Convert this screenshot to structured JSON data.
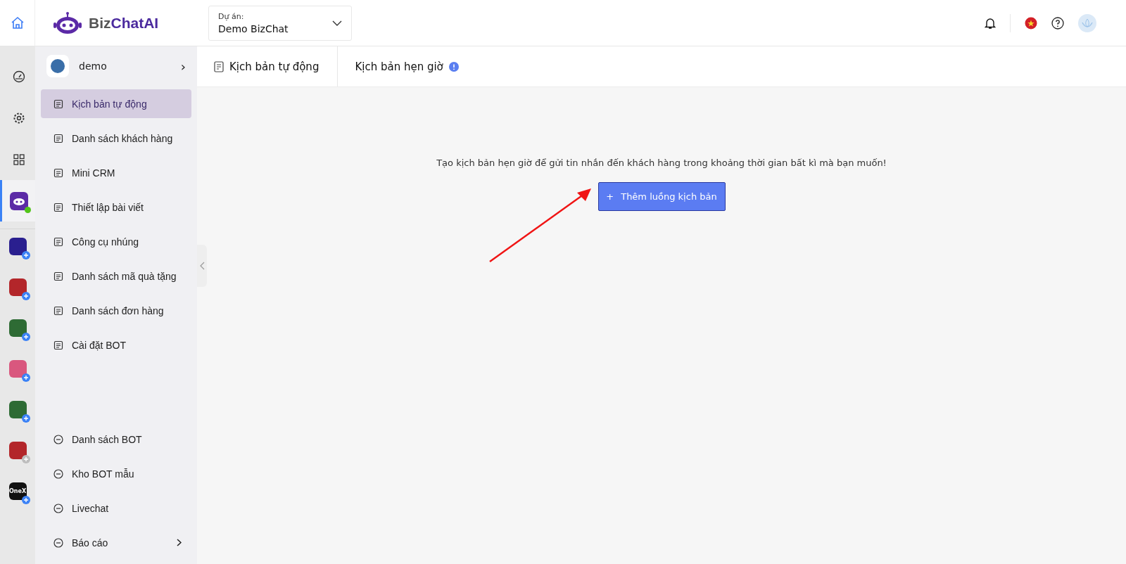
{
  "brand": {
    "name_part_1": "Biz",
    "name_part_2": "ChatAI"
  },
  "project": {
    "label": "Dự án:",
    "value": "Demo BizChat"
  },
  "rail": {
    "items": [
      {
        "selected": false
      },
      {
        "selected": false
      },
      {
        "selected": false
      },
      {
        "selected": true,
        "online": true
      }
    ],
    "apps": [
      {
        "color": "#2a1f8f",
        "badge_active": true
      },
      {
        "color": "#b3262a",
        "badge_active": true
      },
      {
        "color": "#2e6b34",
        "badge_active": true
      },
      {
        "color": "#d9577e",
        "badge_active": true
      },
      {
        "color": "#2e6b34",
        "badge_active": true
      },
      {
        "color": "#b3262a",
        "badge_active": false
      },
      {
        "color": "#111111",
        "badge_active": true,
        "text": "OneX"
      }
    ]
  },
  "workspace": {
    "name": "demo",
    "chevron": "›"
  },
  "nav": {
    "items": [
      {
        "label": "Kịch bản tự động",
        "selected": true
      },
      {
        "label": "Danh sách khách hàng",
        "selected": false
      },
      {
        "label": "Mini CRM",
        "selected": false
      },
      {
        "label": "Thiết lập bài viết",
        "selected": false
      },
      {
        "label": "Công cụ nhúng",
        "selected": false
      },
      {
        "label": "Danh sách mã quà tặng",
        "selected": false
      },
      {
        "label": "Danh sách đơn hàng",
        "selected": false
      },
      {
        "label": "Cài đặt BOT",
        "selected": false
      }
    ],
    "bottom_items": [
      {
        "label": "Danh sách BOT",
        "selected": false,
        "has_submenu": false
      },
      {
        "label": "Kho BOT mẫu",
        "selected": false,
        "has_submenu": false
      },
      {
        "label": "Livechat",
        "selected": false,
        "has_submenu": false
      },
      {
        "label": "Báo cáo",
        "selected": false,
        "has_submenu": true
      }
    ]
  },
  "breadcrumb": [
    {
      "label": "Kịch bản tự động"
    },
    {
      "label": "Kịch bản hẹn giờ",
      "info": true
    }
  ],
  "empty_state": {
    "message": "Tạo kịch bản hẹn giờ để gửi tin nhắn đến khách hàng trong khoảng thời gian bất kì mà bạn muốn!",
    "button": "Thêm luồng kịch bản",
    "button_icon": "+"
  }
}
